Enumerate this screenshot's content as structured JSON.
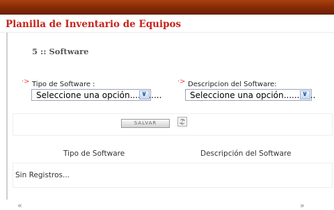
{
  "header": {
    "title": "Planilla de Inventario de Equipos"
  },
  "section": {
    "title": "5 :: Software"
  },
  "form": {
    "tipo": {
      "label": "Tipo de Software :",
      "value": "Seleccione una opción............"
    },
    "descripcion": {
      "label": "Descripcion del Software:",
      "value": "Seleccione una opción............"
    },
    "bullet": "·>"
  },
  "actions": {
    "save_label": "SALVAR"
  },
  "table": {
    "headers": [
      "Tipo de Software",
      "Descripción del Software"
    ],
    "empty_message": "Sin Registros..."
  },
  "pager": {
    "prev": "«",
    "next": "»"
  },
  "icons": {
    "select_arrow": "chevron-down-icon",
    "refresh": "refresh-icon"
  },
  "colors": {
    "topbar": "#8a2d06",
    "title": "#c4231a",
    "required_marker": "#e44444"
  }
}
